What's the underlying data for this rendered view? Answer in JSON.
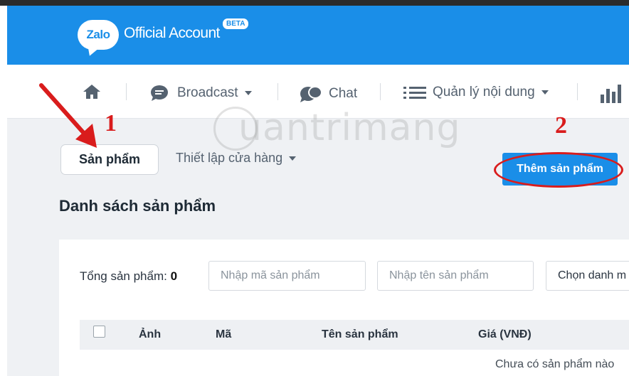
{
  "brand": {
    "logo_text": "Zalo",
    "name": "Official Account",
    "badge": "BETA"
  },
  "nav": {
    "items": [
      {
        "label": "",
        "icon": "home-icon"
      },
      {
        "label": "Broadcast",
        "icon": "chat-bubble-icon",
        "dropdown": true
      },
      {
        "label": "Chat",
        "icon": "chat-icon",
        "dropdown": false
      },
      {
        "label": "Quản lý nội dung",
        "icon": "list-icon",
        "dropdown": true
      },
      {
        "label": "",
        "icon": "bar-chart-icon"
      }
    ]
  },
  "tabs": {
    "products": "Sản phẩm",
    "store_settings": "Thiết lập cửa hàng"
  },
  "actions": {
    "add_product": "Thêm sản phẩm"
  },
  "page": {
    "title": "Danh sách sản phẩm"
  },
  "filters": {
    "total_label": "Tổng sản phẩm:",
    "total_value": "0",
    "code_placeholder": "Nhập mã sản phẩm",
    "name_placeholder": "Nhập tên sản phẩm",
    "category_select": "Chọn danh m"
  },
  "table": {
    "columns": [
      "Ảnh",
      "Mã",
      "Tên sản phẩm",
      "Giá (VNĐ)"
    ],
    "empty_text": "Chưa có sản phẩm nào"
  },
  "annotations": {
    "step1": "1",
    "step2": "2"
  },
  "watermark": "uantrimang",
  "colors": {
    "brand_blue": "#1a8ee8",
    "annotation_red": "#d91c1c",
    "content_bg": "#eff1f4"
  }
}
